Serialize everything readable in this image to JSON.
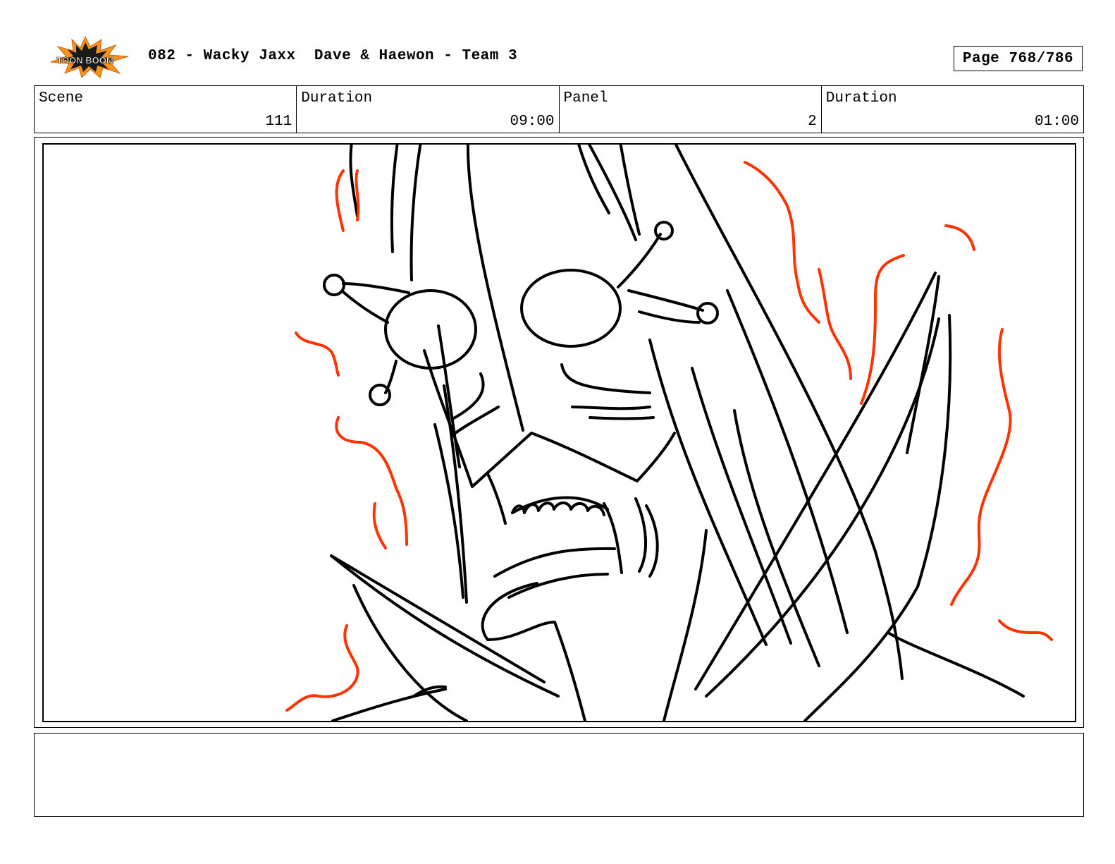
{
  "header": {
    "logo_text": "TOON BOOM",
    "title": "082 - Wacky Jaxx  Dave & Haewon - Team 3",
    "page": "Page 768/786"
  },
  "info": {
    "scene_label": "Scene",
    "scene_value": "111",
    "scene_duration_label": "Duration",
    "scene_duration_value": "09:00",
    "panel_label": "Panel",
    "panel_value": "2",
    "panel_duration_label": "Duration",
    "panel_duration_value": "01:00"
  },
  "notes": {
    "text": ""
  },
  "colors": {
    "ink": "#000000",
    "rage_lines": "#ff3300",
    "logo_burst": "#f7941d"
  }
}
